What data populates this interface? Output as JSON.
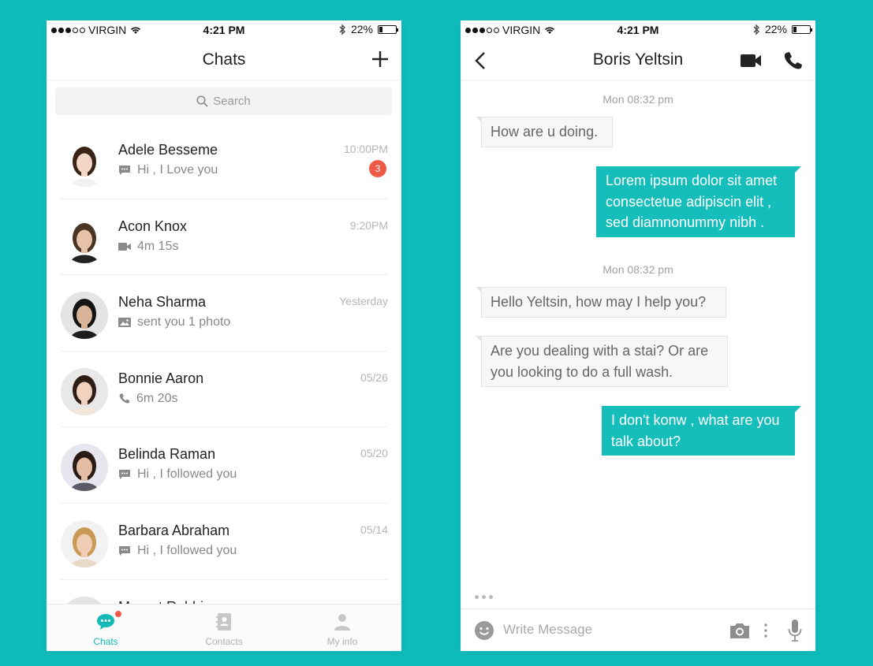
{
  "colors": {
    "background": "#0fbcbc",
    "accent": "#15bdbb",
    "badge": "#ef5a46",
    "incoming_bubble": "#f7f7f7"
  },
  "status_bar": {
    "carrier": "VIRGIN",
    "time": "4:21 PM",
    "battery": "22%",
    "battery_level": 0.22
  },
  "chats_screen": {
    "title": "Chats",
    "search_placeholder": "Search",
    "items": [
      {
        "name": "Adele Besseme",
        "preview": "Hi , I Love you",
        "preview_icon": "message-icon",
        "time": "10:00PM",
        "unread": "3"
      },
      {
        "name": "Acon Knox",
        "preview": "4m 15s",
        "preview_icon": "video-icon",
        "time": "9:20PM"
      },
      {
        "name": "Neha Sharma",
        "preview": "sent you 1 photo",
        "preview_icon": "photo-icon",
        "time": "Yesterday"
      },
      {
        "name": "Bonnie  Aaron",
        "preview": "6m 20s",
        "preview_icon": "phone-icon",
        "time": "05/26"
      },
      {
        "name": "Belinda Raman",
        "preview": "Hi , I followed you",
        "preview_icon": "message-icon",
        "time": "05/20"
      },
      {
        "name": "Barbara  Abraham",
        "preview": "Hi , I followed you",
        "preview_icon": "message-icon",
        "time": "05/14"
      },
      {
        "name": "Margot Robbie",
        "preview": "",
        "preview_icon": "message-icon",
        "time": ""
      }
    ],
    "tabs": [
      {
        "label": "Chats",
        "icon": "chat-bubble-icon",
        "active": true
      },
      {
        "label": "Contacts",
        "icon": "contacts-book-icon",
        "active": false
      },
      {
        "label": "My info",
        "icon": "person-icon",
        "active": false
      }
    ]
  },
  "conversation_screen": {
    "title": "Boris Yeltsin",
    "messages": [
      {
        "type": "date",
        "text": "Mon 08:32 pm"
      },
      {
        "type": "in",
        "text": "How are u doing."
      },
      {
        "type": "out",
        "text": "Lorem ipsum dolor sit amet consectetue adipiscin elit , sed diamnonummy nibh ."
      },
      {
        "type": "date",
        "text": "Mon 08:32 pm"
      },
      {
        "type": "in",
        "text": "Hello Yeltsin, how may I help you?"
      },
      {
        "type": "in",
        "text": "Are you dealing with a stai? Or are you looking to do a full wash."
      },
      {
        "type": "out",
        "text": "I don't konw , what are you talk about?"
      }
    ],
    "input_placeholder": "Write Message"
  }
}
